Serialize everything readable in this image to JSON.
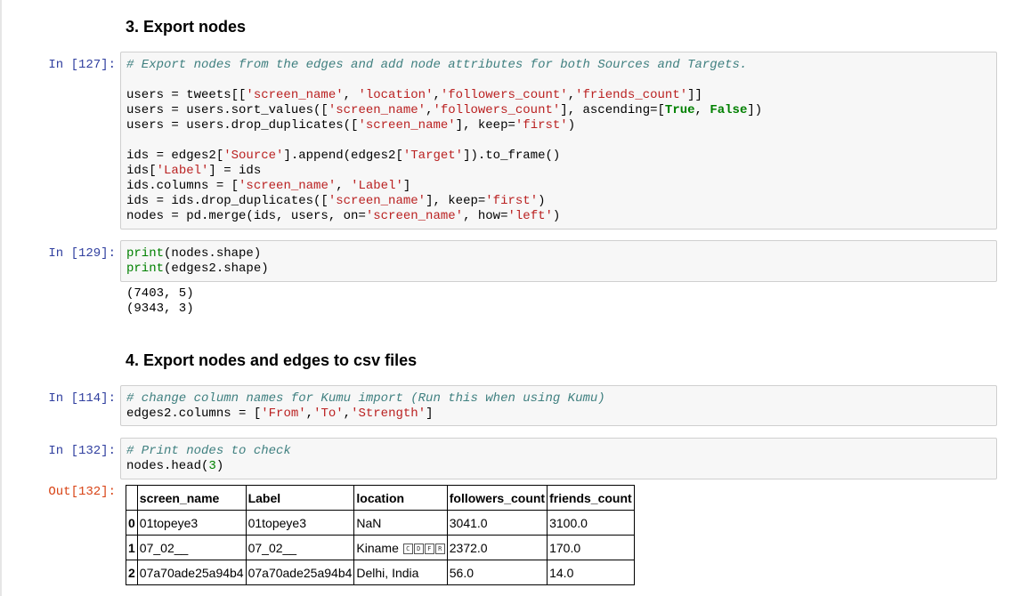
{
  "section3": {
    "heading": "3. Export nodes"
  },
  "cell127": {
    "prompt": "In [127]:",
    "lines": [
      "# Export nodes from the edges and add node attributes for both Sources and Targets.",
      "",
      "users = tweets[['screen_name', 'location','followers_count','friends_count']]",
      "users = users.sort_values(['screen_name','followers_count'], ascending=[True, False])",
      "users = users.drop_duplicates(['screen_name'], keep='first')",
      "",
      "ids = edges2['Source'].append(edges2['Target']).to_frame()",
      "ids['Label'] = ids",
      "ids.columns = ['screen_name', 'Label']",
      "ids = ids.drop_duplicates(['screen_name'], keep='first')",
      "nodes = pd.merge(ids, users, on='screen_name', how='left')"
    ]
  },
  "cell129": {
    "prompt": "In [129]:",
    "lines": [
      "print(nodes.shape)",
      "print(edges2.shape)"
    ],
    "output": [
      "(7403, 5)",
      "(9343, 3)"
    ]
  },
  "section4": {
    "heading": "4. Export nodes and edges to csv files"
  },
  "cell114": {
    "prompt": "In [114]:",
    "lines": [
      "# change column names for Kumu import (Run this when using Kumu)",
      "edges2.columns = ['From','To','Strength']"
    ]
  },
  "cell132": {
    "prompt": "In [132]:",
    "out_prompt": "Out[132]:",
    "lines": [
      "# Print nodes to check",
      "nodes.head(3)"
    ],
    "table": {
      "columns": [
        "",
        "screen_name",
        "Label",
        "location",
        "followers_count",
        "friends_count"
      ],
      "rows": [
        [
          "0",
          "01topeye3",
          "01topeye3",
          "NaN",
          "3041.0",
          "3100.0"
        ],
        [
          "1",
          "07_02__",
          "07_02__",
          "Kiname",
          "2372.0",
          "170.0"
        ],
        [
          "2",
          "07a70ade25a94b4",
          "07a70ade25a94b4",
          "Delhi, India",
          "56.0",
          "14.0"
        ]
      ],
      "unrendered_glyphs": [
        "C",
        "D",
        "F",
        "R"
      ]
    }
  }
}
